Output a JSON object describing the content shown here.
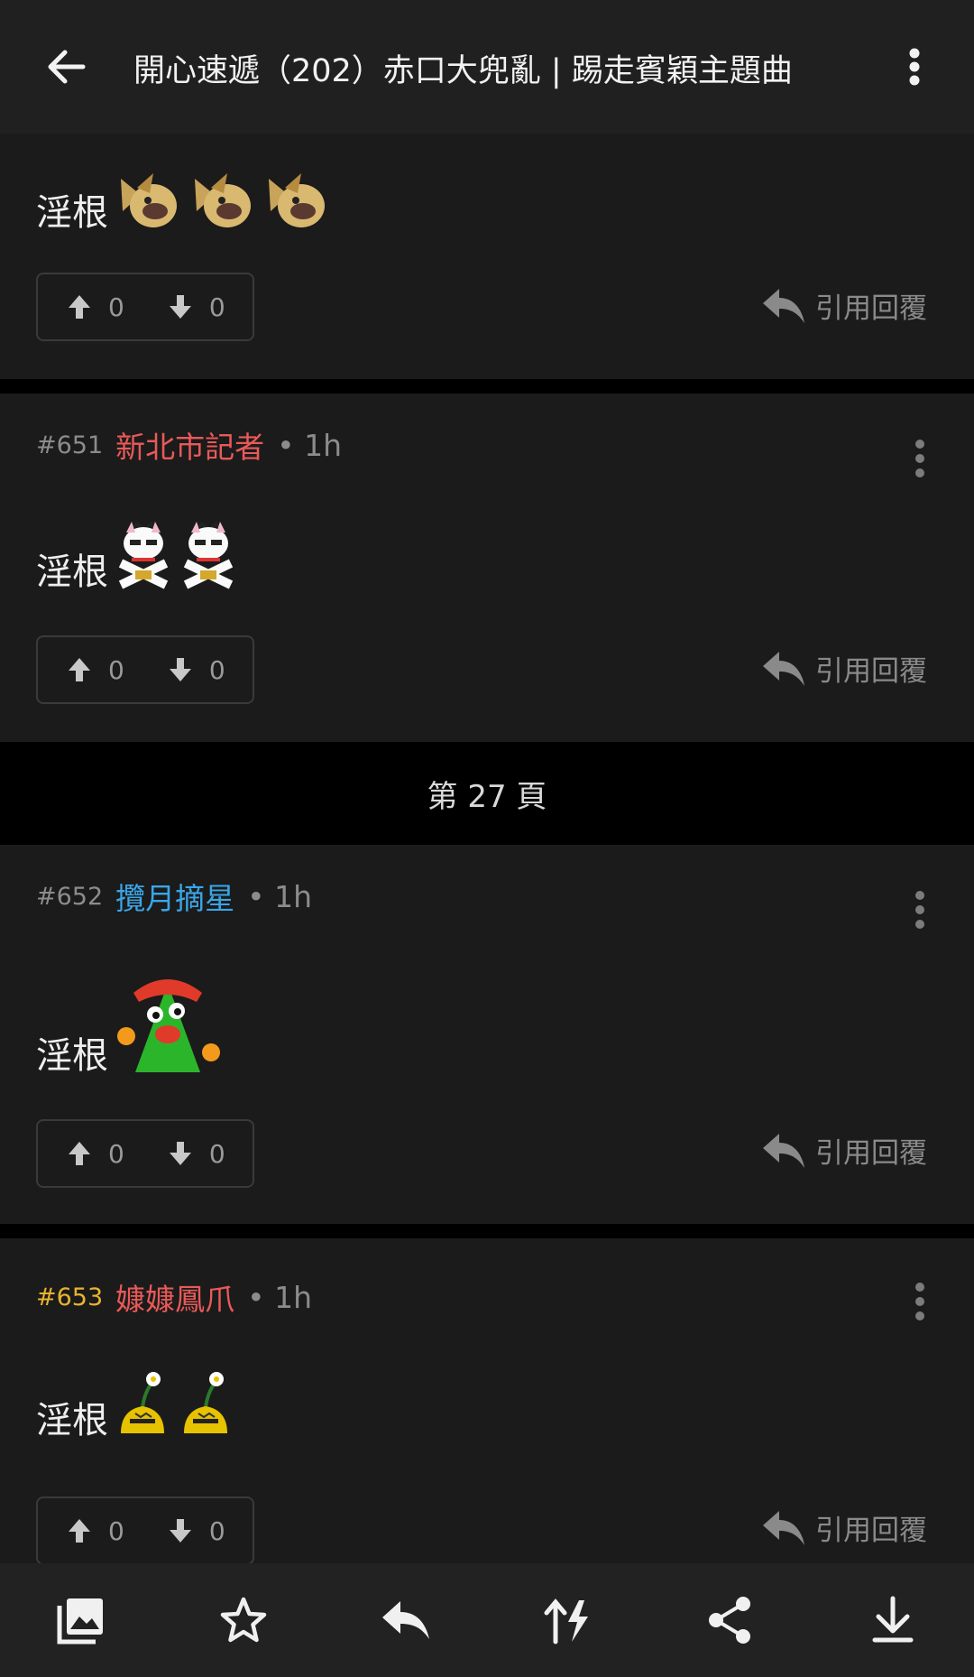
{
  "header": {
    "title": "開心速遞（202）赤口大兜亂 | 踢走賓穎主題曲",
    "back_icon": "back-arrow-icon",
    "menu_icon": "more-vert-icon"
  },
  "posts": [
    {
      "floor": "",
      "author": "",
      "time": "",
      "text": "淫根",
      "emoji_count": 3,
      "emoji_icon": "golden-dog-emoji-icon",
      "upvotes": "0",
      "downvotes": "0",
      "quote_label": "引用回覆"
    },
    {
      "floor": "#651",
      "author": "新北市記者",
      "time": "• 1h",
      "author_color": "#e85a58",
      "text": "淫根",
      "emoji_count": 2,
      "emoji_icon": "lucky-cat-emoji-icon",
      "upvotes": "0",
      "downvotes": "0",
      "quote_label": "引用回覆"
    },
    {
      "floor": "#652",
      "author": "攬月摘星",
      "time": "• 1h",
      "author_color": "#3aa6e8",
      "text": "淫根",
      "emoji_count": 1,
      "emoji_icon": "green-blob-emoji-icon",
      "upvotes": "0",
      "downvotes": "0",
      "quote_label": "引用回覆"
    },
    {
      "floor": "#653",
      "author": "嫝嫝鳳爪",
      "time": "• 1h",
      "author_color": "#e85a58",
      "floor_color": "#e9b32f",
      "text": "淫根",
      "emoji_count": 2,
      "emoji_icon": "flower-bell-emoji-icon",
      "upvotes": "0",
      "downvotes": "0",
      "quote_label": "引用回覆"
    }
  ],
  "page_divider": {
    "label": "第 27 頁"
  },
  "toolbar": {
    "items": [
      {
        "icon": "gallery-icon"
      },
      {
        "icon": "star-icon"
      },
      {
        "icon": "reply-icon"
      },
      {
        "icon": "sort-flash-icon"
      },
      {
        "icon": "share-icon"
      },
      {
        "icon": "download-icon"
      }
    ]
  },
  "colors": {
    "background": "#1b1b1b",
    "header": "#202020",
    "author_red": "#e85a58",
    "author_blue": "#3aa6e8",
    "floor_gold": "#e9b32f"
  }
}
